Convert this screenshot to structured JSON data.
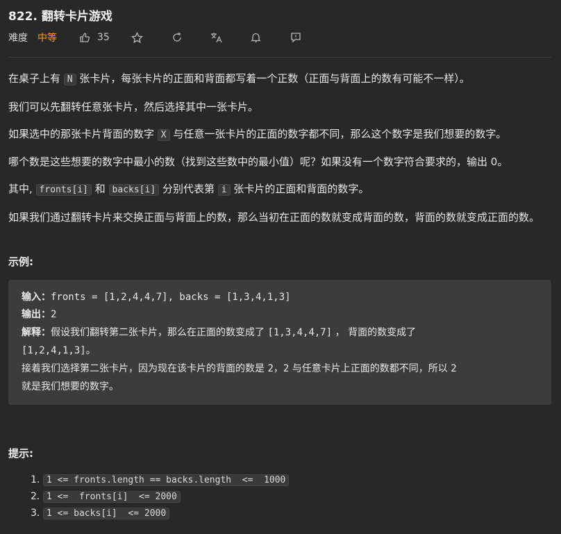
{
  "title": "822. 翻转卡片游戏",
  "meta": {
    "difficulty_label": "难度",
    "difficulty_value": "中等",
    "likes": "35",
    "icons": [
      "thumbs-up-icon",
      "star-icon",
      "share-icon",
      "translate-icon",
      "bell-icon",
      "feedback-icon"
    ]
  },
  "colors": {
    "accent": "#ffa116",
    "background": "#282828",
    "example_bg": "#3c3c3c"
  },
  "description": {
    "p1": {
      "a": "在桌子上有 ",
      "code": "N",
      "b": " 张卡片，每张卡片的正面和背面都写着一个正数（正面与背面上的数有可能不一样）。"
    },
    "p2": "我们可以先翻转任意张卡片，然后选择其中一张卡片。",
    "p3": {
      "a": "如果选中的那张卡片背面的数字 ",
      "code": "X",
      "b": " 与任意一张卡片的正面的数字都不同，那么这个数字是我们想要的数字。"
    },
    "p4": "哪个数是这些想要的数字中最小的数（找到这些数中的最小值）呢？如果没有一个数字符合要求的，输出 0。",
    "p5": {
      "a": "其中, ",
      "code1": "fronts[i]",
      "b": " 和 ",
      "code2": "backs[i]",
      "c": " 分别代表第 ",
      "code3": "i",
      "d": " 张卡片的正面和背面的数字。"
    },
    "p6": "如果我们通过翻转卡片来交换正面与背面上的数，那么当初在正面的数就变成背面的数，背面的数就变成正面的数。"
  },
  "example": {
    "heading": "示例:",
    "input_label": "输入：",
    "input_value": "fronts = [1,2,4,4,7], backs = [1,3,4,1,3]",
    "output_label": "输出：",
    "output_value": "2",
    "explain_label": "解释：",
    "explain_1a": "假设我们翻转第二张卡片，那么在正面的数变成了 ",
    "explain_1b": "[1,3,4,4,7]",
    "explain_1c": " ， 背面的数变成了",
    "explain_2": "[1,2,4,1,3]。",
    "explain_3a": "接着我们选择第二张卡片，因为现在该卡片的背面的数是 ",
    "explain_3b": "2",
    "explain_3c": "，",
    "explain_3d": "2",
    "explain_3e": " 与任意卡片上正面的数都不同，所以 ",
    "explain_3f": "2",
    "explain_4": "就是我们想要的数字。"
  },
  "hints": {
    "heading": "提示:",
    "items": [
      {
        "num": "1.",
        "text": "1 <= fronts.length == backs.length  <=  1000"
      },
      {
        "num": "2.",
        "text": "1 <=  fronts[i]  <= 2000"
      },
      {
        "num": "3.",
        "text": "1 <= backs[i]  <= 2000"
      }
    ]
  }
}
